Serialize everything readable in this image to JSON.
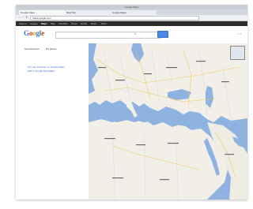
{
  "os": {
    "title": "Google Maps"
  },
  "browser": {
    "tabs": [
      {
        "label": "Google Maps"
      },
      {
        "label": "New Tab"
      },
      {
        "label": "Google Maps"
      }
    ],
    "address": "maps.google.com"
  },
  "gbar": {
    "items": [
      "Search",
      "Images",
      "Maps",
      "Play",
      "YouTube",
      "News",
      "Gmail",
      "Drive",
      "More"
    ]
  },
  "google_logo": {
    "g1": "G",
    "o1": "o",
    "o2": "o",
    "g2": "g",
    "l": "l",
    "e": "e"
  },
  "sidebar": {
    "tabs": [
      "Get directions",
      "My places"
    ],
    "links": [
      "Put your business on Google Maps",
      "Edit in Google Map Maker"
    ]
  },
  "colors": {
    "screen_bg": "#1e5fa3",
    "water": "#8fb3e0",
    "land": "#f1efe8",
    "search_button": "#4d86e6"
  },
  "icons": [
    "search-icon",
    "back-icon",
    "forward-icon",
    "reload-icon",
    "zoom-control-icon"
  ]
}
